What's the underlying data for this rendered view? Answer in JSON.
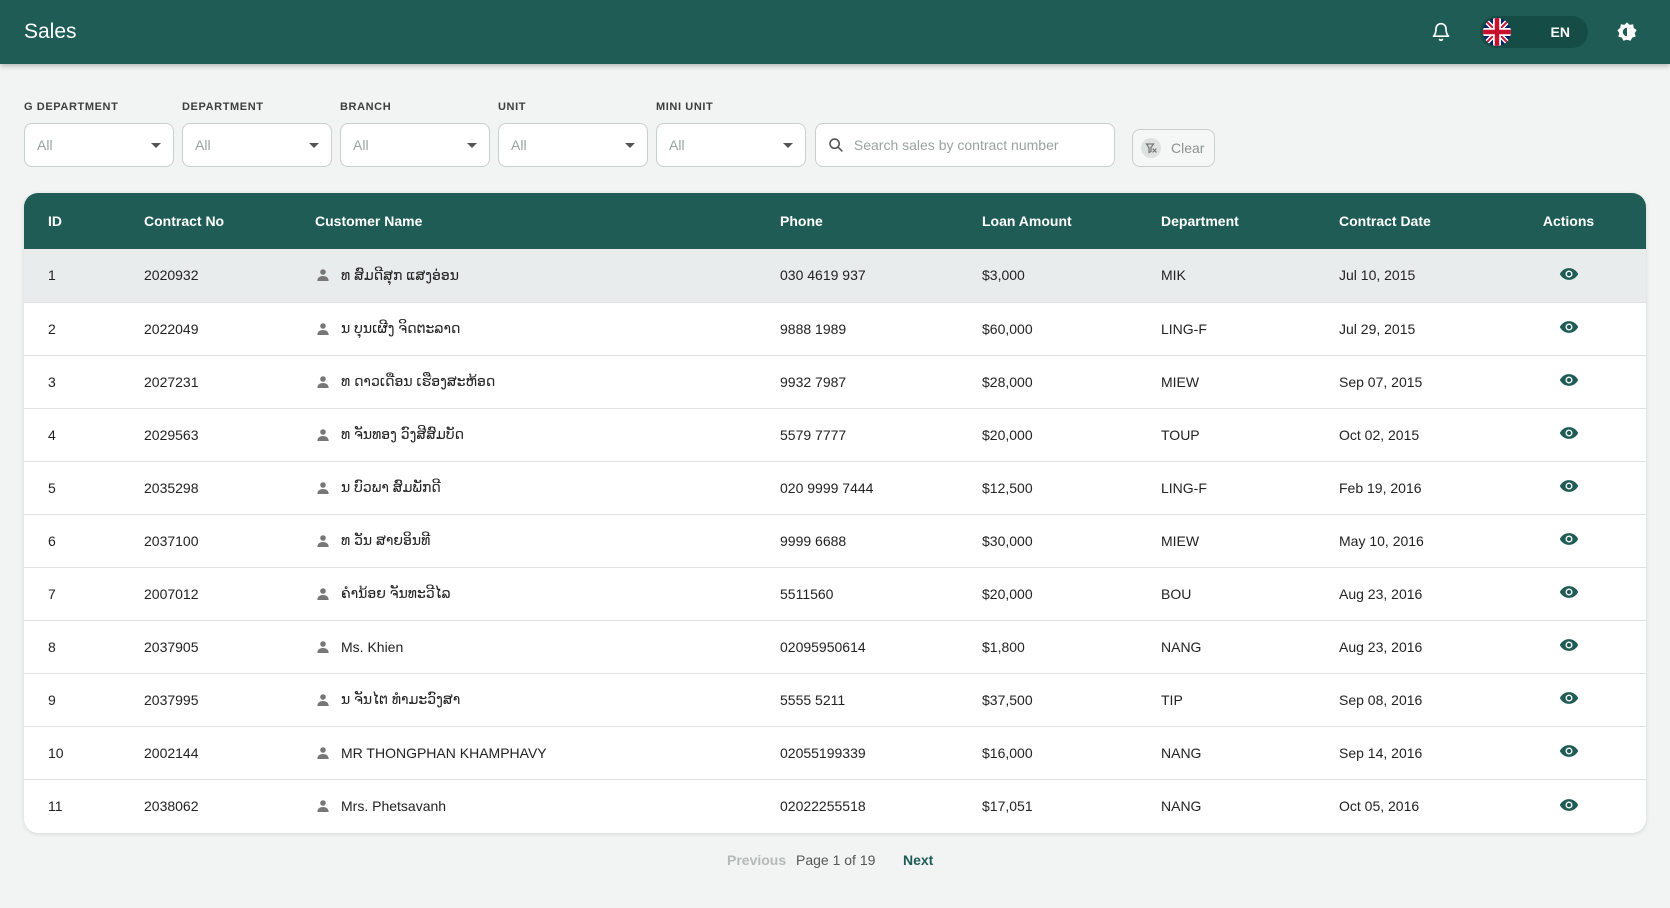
{
  "header": {
    "title": "Sales",
    "language": "EN"
  },
  "filters": [
    {
      "label": "G DEPARTMENT",
      "value": "All"
    },
    {
      "label": "DEPARTMENT",
      "value": "All"
    },
    {
      "label": "BRANCH",
      "value": "All"
    },
    {
      "label": "UNIT",
      "value": "All"
    },
    {
      "label": "MINI UNIT",
      "value": "All"
    }
  ],
  "search": {
    "placeholder": "Search sales by contract number",
    "value": ""
  },
  "clear_label": "Clear",
  "table": {
    "columns": [
      "ID",
      "Contract No",
      "Customer Name",
      "Phone",
      "Loan Amount",
      "Department",
      "Contract Date",
      "Actions"
    ],
    "rows": [
      {
        "id": "1",
        "contract_no": "2020932",
        "customer": "ທ ສົມດີສຸກ ແສງອ່ອນ",
        "phone": "030 4619 937",
        "amount": "$3,000",
        "department": "MIK",
        "date": "Jul 10, 2015"
      },
      {
        "id": "2",
        "contract_no": "2022049",
        "customer": "ນ ບຸນເຜີງ ຈິດຕະລາດ",
        "phone": "9888 1989",
        "amount": "$60,000",
        "department": "LING-F",
        "date": "Jul 29, 2015"
      },
      {
        "id": "3",
        "contract_no": "2027231",
        "customer": "ທ ດາວເດືອນ ເຮືອງສະຫ້ອດ",
        "phone": "9932 7987",
        "amount": "$28,000",
        "department": "MIEW",
        "date": "Sep 07, 2015"
      },
      {
        "id": "4",
        "contract_no": "2029563",
        "customer": "ທ ຈັນທອງ ວົງສີສົມບັດ",
        "phone": "5579 7777",
        "amount": "$20,000",
        "department": "TOUP",
        "date": "Oct 02, 2015"
      },
      {
        "id": "5",
        "contract_no": "2035298",
        "customer": "ນ ບົວພາ ສົມພັກດີ",
        "phone": "020 9999 7444",
        "amount": "$12,500",
        "department": "LING-F",
        "date": "Feb 19, 2016"
      },
      {
        "id": "6",
        "contract_no": "2037100",
        "customer": "ທ ວັນ ສາຍອິນທີ",
        "phone": "9999 6688",
        "amount": "$30,000",
        "department": "MIEW",
        "date": "May 10, 2016"
      },
      {
        "id": "7",
        "contract_no": "2007012",
        "customer": "ຄຳນ້ອຍ ຈັນທະວີໄລ",
        "phone": "5511560",
        "amount": "$20,000",
        "department": "BOU",
        "date": "Aug 23, 2016"
      },
      {
        "id": "8",
        "contract_no": "2037905",
        "customer": "Ms. Khien",
        "phone": "02095950614",
        "amount": "$1,800",
        "department": "NANG",
        "date": "Aug 23, 2016"
      },
      {
        "id": "9",
        "contract_no": "2037995",
        "customer": "ນ ຈັນໄຕ ທຳມະວົງສາ",
        "phone": "5555 5211",
        "amount": "$37,500",
        "department": "TIP",
        "date": "Sep 08, 2016"
      },
      {
        "id": "10",
        "contract_no": "2002144",
        "customer": "MR THONGPHAN KHAMPHAVY",
        "phone": "02055199339",
        "amount": "$16,000",
        "department": "NANG",
        "date": "Sep 14, 2016"
      },
      {
        "id": "11",
        "contract_no": "2038062",
        "customer": "Mrs. Phetsavanh",
        "phone": "02022255518",
        "amount": "$17,051",
        "department": "NANG",
        "date": "Oct 05, 2016"
      }
    ]
  },
  "pagination": {
    "previous_label": "Previous",
    "info": "Page 1 of 19",
    "next_label": "Next"
  },
  "colors": {
    "primary": "#1f5c55",
    "background": "#f1f4f3",
    "selected_row": "#e8ecec"
  },
  "icons": [
    "bell-icon",
    "uk-flag-icon",
    "theme-toggle-icon",
    "chevron-down-icon",
    "search-icon",
    "filter-clear-icon",
    "person-icon",
    "eye-icon"
  ]
}
